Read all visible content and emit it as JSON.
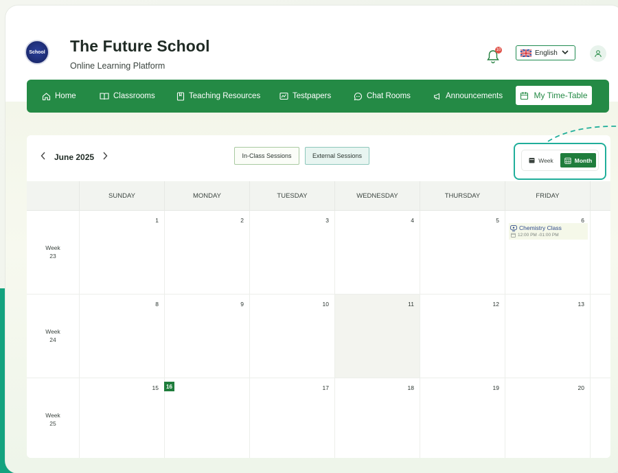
{
  "header": {
    "logo_text": "School",
    "title": "The Future School",
    "subtitle": "Online Learning Platform",
    "notification_count": "10",
    "language": "English"
  },
  "nav": {
    "items": [
      {
        "label": "Home",
        "icon": "home-icon"
      },
      {
        "label": "Classrooms",
        "icon": "book-open-icon"
      },
      {
        "label": "Teaching Resources",
        "icon": "bookmark-book-icon"
      },
      {
        "label": "Testpapers",
        "icon": "chart-board-icon"
      },
      {
        "label": "Chat Rooms",
        "icon": "chat-bubble-icon"
      },
      {
        "label": "Announcements",
        "icon": "megaphone-icon"
      }
    ],
    "active": {
      "label": "My Time-Table",
      "icon": "calendar-icon"
    }
  },
  "calendar": {
    "month_label": "June 2025",
    "sessions": {
      "in_class": "In-Class Sessions",
      "external": "External Sessions"
    },
    "view": {
      "week": "Week",
      "month": "Month",
      "selected": "Month"
    },
    "days": [
      "SUNDAY",
      "MONDAY",
      "TUESDAY",
      "WEDNESDAY",
      "THURSDAY",
      "FRIDAY"
    ],
    "weeks": [
      {
        "label": "Week",
        "number": "23",
        "dates": [
          "1",
          "2",
          "3",
          "4",
          "5",
          "6"
        ]
      },
      {
        "label": "Week",
        "number": "24",
        "dates": [
          "8",
          "9",
          "10",
          "11",
          "12",
          "13"
        ]
      },
      {
        "label": "Week",
        "number": "25",
        "dates": [
          "15",
          "16",
          "17",
          "18",
          "19",
          "20"
        ]
      }
    ],
    "today": "16",
    "event": {
      "title": "Chemistry Class",
      "time": "12:00 PM -01:00 PM"
    }
  },
  "colors": {
    "primary_green": "#248a45",
    "active_dark_green": "#1f7d3c",
    "highlight_teal": "#1fae9a",
    "event_blue": "#2f4a8a"
  }
}
